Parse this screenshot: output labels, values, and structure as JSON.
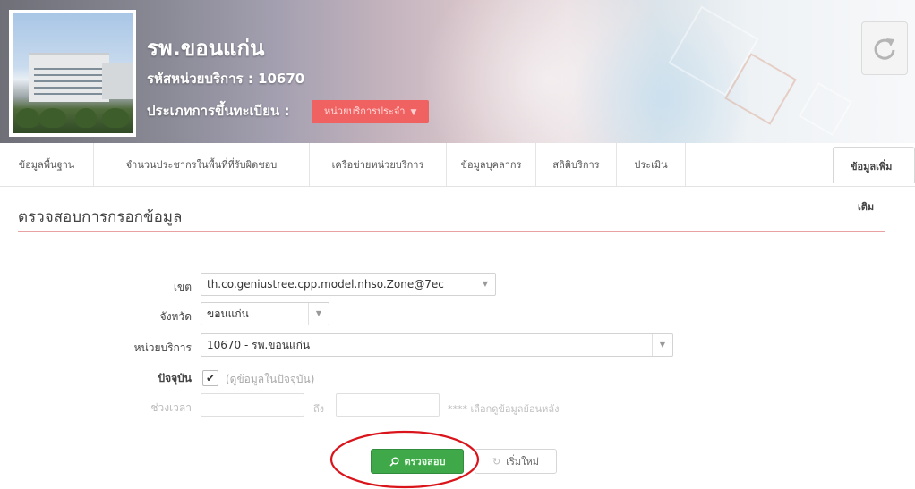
{
  "header": {
    "hospital_name": "รพ.ขอนแก่น",
    "service_code": "รหัสหน่วยบริการ : 10670",
    "registration_label": "ประเภทการขึ้นทะเบียน :",
    "registration_type": "หน่วยบริการประจำ",
    "refresh_icon": "refresh-icon"
  },
  "nav": {
    "tabs": [
      "ข้อมูลพื้นฐาน",
      "จำนวนประชากรในพื้นที่ที่รับผิดชอบ",
      "เครือข่ายหน่วยบริการ",
      "ข้อมูลบุคลากร",
      "สถิติบริการ",
      "ประเมิน"
    ],
    "more_line1": "ข้อมูลเพิ่ม",
    "more_line2": "เติม"
  },
  "section": {
    "title": "ตรวจสอบการกรอกข้อมูล"
  },
  "form": {
    "zone_label": "เขต",
    "zone_value": "th.co.geniustree.cpp.model.nhso.Zone@7ec",
    "province_label": "จังหวัด",
    "province_value": "ขอนแก่น",
    "unit_label": "หน่วยบริการ",
    "unit_value": "10670 - รพ.ขอนแก่น",
    "current_label": "ปัจจุบัน",
    "current_checked": true,
    "current_hint": "(ดูข้อมูลในปัจจุบัน)",
    "period_label": "ช่วงเวลา",
    "to_label": "ถึง",
    "period_hint": "**** เลือกดูข้อมูลย้อนหลัง"
  },
  "buttons": {
    "check_label": "ตรวจสอบ",
    "reset_label": "เริ่มใหม่"
  },
  "colors": {
    "badge": "#f06261",
    "check_button": "#3fa94a",
    "section_rule": "#e8a2a2",
    "annotation": "#d9151b"
  }
}
